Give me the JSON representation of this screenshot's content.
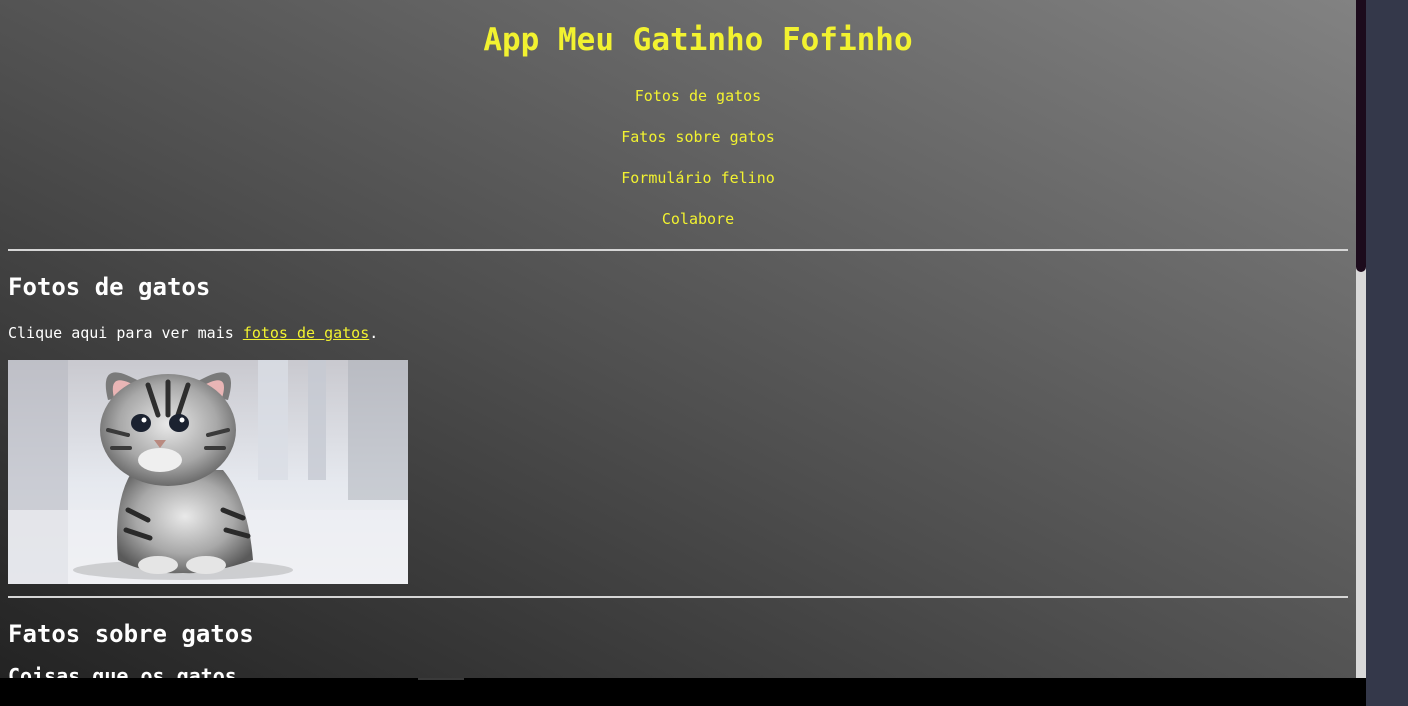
{
  "header": {
    "title": "App Meu Gatinho Fofinho"
  },
  "nav": {
    "items": [
      {
        "label": "Fotos de gatos"
      },
      {
        "label": "Fatos sobre gatos"
      },
      {
        "label": "Formulário felino"
      },
      {
        "label": "Colabore"
      }
    ]
  },
  "photos_section": {
    "title": "Fotos de gatos",
    "text_before": "Clique aqui para ver mais ",
    "link_text": "fotos de gatos",
    "text_after": "."
  },
  "facts_section": {
    "title": "Fatos sobre gatos",
    "partial_text": "Coisas que os gatos"
  },
  "colors": {
    "accent": "#f2f230",
    "text": "#ffffff",
    "divider": "#d6d6d6"
  }
}
